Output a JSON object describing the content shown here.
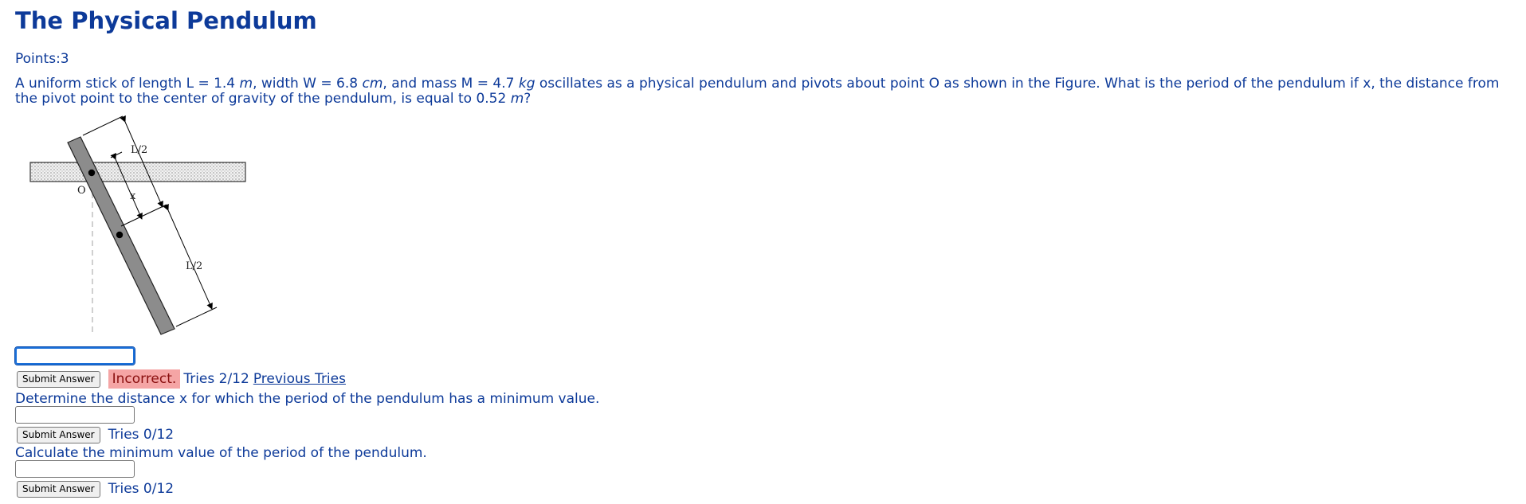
{
  "page": {
    "title": "The Physical Pendulum",
    "points": "Points:3"
  },
  "question": {
    "p1": "A uniform stick of length L = 1.4 ",
    "u1": "m",
    "p2": ", width W = 6.8 ",
    "u2": "cm",
    "p3": ", and mass M = 4.7 ",
    "u3": "kg",
    "p4": " oscillates as a physical pendulum and pivots about point O as shown in the Figure. What is the period of the pendulum if x, the distance from the pivot point to the center of gravity of the pendulum, is equal to 0.52 ",
    "u4": "m",
    "p5": "?"
  },
  "figure": {
    "label_top": "L/2",
    "label_bottom": "L/2",
    "label_x": "x",
    "label_o": "O"
  },
  "part1": {
    "input_value": "",
    "submit_label": "Submit Answer",
    "feedback": "Incorrect.",
    "tries": "Tries 2/12",
    "previous_tries": "Previous Tries"
  },
  "part2": {
    "prompt": "Determine the distance x for which the period of the pendulum has a minimum value.",
    "input_value": "",
    "submit_label": "Submit Answer",
    "tries": "Tries 0/12"
  },
  "part3": {
    "prompt": "Calculate the minimum value of the period of the pendulum.",
    "input_value": "",
    "submit_label": "Submit Answer",
    "tries": "Tries 0/12"
  },
  "colors": {
    "text": "#0d3a99",
    "incorrect_bg": "#f5a5a5",
    "incorrect_text": "#8a0f0f",
    "stick": "#8c8c8c"
  }
}
